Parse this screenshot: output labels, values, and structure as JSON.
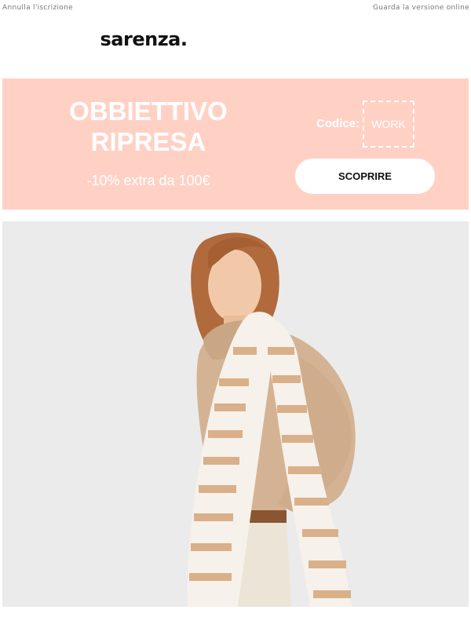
{
  "header": {
    "unsubscribe_label": "Annulla l'iscrizione",
    "view_online_label": "Guarda la versione online",
    "logo_text": "sarenza."
  },
  "banner": {
    "headline_line1": "OBBIETTIVO",
    "headline_line2": "RIPRESA",
    "subline": "-10% extra da 100€",
    "code_label": "Codice:",
    "code_value": "WORK",
    "cta_label": "SCOPRIRE",
    "background_color": "#ffd1c5"
  },
  "hero": {
    "icon": "model-photo",
    "background_color": "#ebebeb"
  }
}
